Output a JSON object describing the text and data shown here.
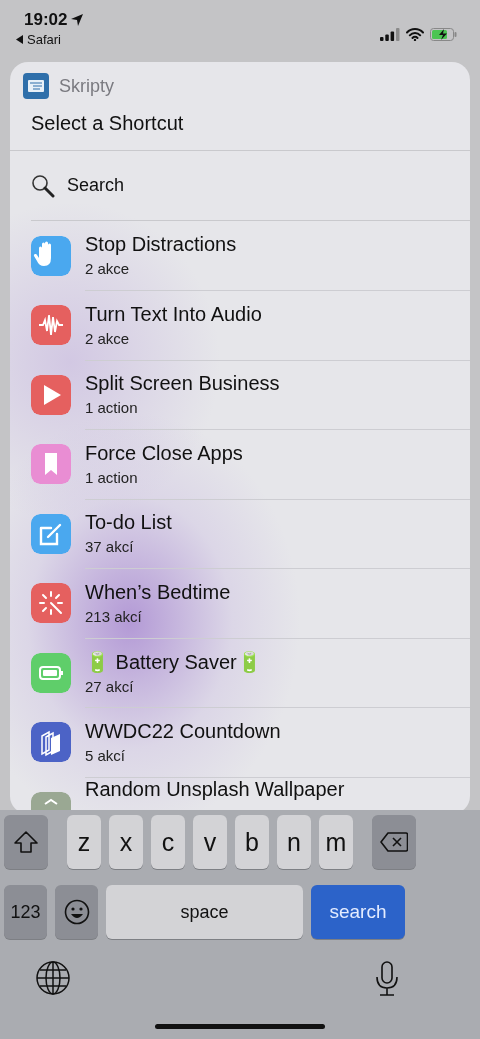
{
  "status_bar": {
    "time": "19:02",
    "back_app": "Safari"
  },
  "sheet": {
    "app_name": "Skripty",
    "title": "Select a Shortcut",
    "search": {
      "placeholder": "Search"
    },
    "shortcuts": [
      {
        "title": "Stop Distractions",
        "subtitle": "2 akce",
        "kind": "hand",
        "color": "#4aa8ef"
      },
      {
        "title": "Turn Text Into Audio",
        "subtitle": "2 akce",
        "kind": "waveform",
        "color": "#e5605f"
      },
      {
        "title": "Split Screen Business",
        "subtitle": "1 action",
        "kind": "play",
        "color": "#e5605f"
      },
      {
        "title": "Force Close Apps",
        "subtitle": "1 action",
        "kind": "bookmark",
        "color": "#e98dd3"
      },
      {
        "title": "To-do List",
        "subtitle": "37 akcí",
        "kind": "compose",
        "color": "#4aa8ef"
      },
      {
        "title": "When’s Bedtime",
        "subtitle": "213 akcí",
        "kind": "wand",
        "color": "#e5605f"
      },
      {
        "title": "🔋 Battery Saver🔋",
        "subtitle": "27 akcí",
        "kind": "battery",
        "color": "#5fce6a"
      },
      {
        "title": "WWDC22 Countdown",
        "subtitle": "5 akcí",
        "kind": "stack",
        "color": "#4c63c6"
      },
      {
        "title": "Random Unsplash Wallpaper",
        "kind": "chevron",
        "color": "#9aa893"
      }
    ]
  },
  "keyboard": {
    "letters": [
      "z",
      "x",
      "c",
      "v",
      "b",
      "n",
      "m"
    ],
    "numbers_key": "123",
    "space_key": "space",
    "action_key": "search"
  }
}
